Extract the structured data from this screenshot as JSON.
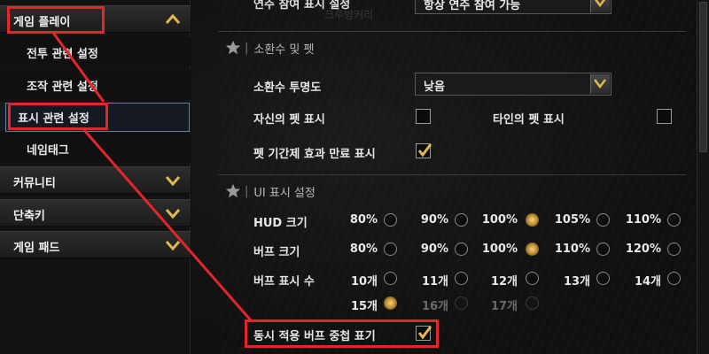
{
  "sidebar": {
    "game_play": "게임 플레이",
    "sub_items": [
      "전투 관련 설정",
      "조작 관련 설정",
      "표시 관련 설정",
      "네임태그"
    ],
    "community": "커뮤니티",
    "shortcut": "단축키",
    "gamepad": "게임 패드",
    "selected": "표시 관련 설정"
  },
  "top_row": {
    "label": "연주 참여 표시 설정",
    "value": "항상 연주 참여 가능",
    "ghost": "크루방커리"
  },
  "summon_section": {
    "title": "소환수 및 펫",
    "opacity_label": "소환수 투명도",
    "opacity_value": "낮음",
    "own_pet_label": "자신의 펫 표시",
    "own_pet_checked": false,
    "other_pet_label": "타인의 펫 표시",
    "other_pet_checked": false,
    "pet_expiry_label": "펫 기간제 효과 만료 표시",
    "pet_expiry_checked": true
  },
  "ui_section": {
    "title": "UI 표시 설정",
    "hud_label": "HUD 크기",
    "hud_options": [
      "80%",
      "90%",
      "100%",
      "105%",
      "110%"
    ],
    "hud_selected": "100%",
    "buff_size_label": "버프 크기",
    "buff_size_options": [
      "80%",
      "90%",
      "100%",
      "110%",
      "120%"
    ],
    "buff_size_selected": "100%",
    "buff_count_label": "버프 표시 수",
    "buff_count_row1": [
      "10개",
      "11개",
      "12개",
      "13개",
      "14개"
    ],
    "buff_count_row2": [
      "15개",
      "16개",
      "17개"
    ],
    "buff_count_selected": "15개",
    "buff_count_disabled": [
      "16개",
      "17개"
    ],
    "stack_buff_label": "동시 적용 버프 중첩 표기",
    "stack_buff_checked": true
  },
  "colors": {
    "annotation_red": "#e2262c",
    "accent_gold": "#e0b850",
    "selected_outline": "#6b7c95"
  }
}
